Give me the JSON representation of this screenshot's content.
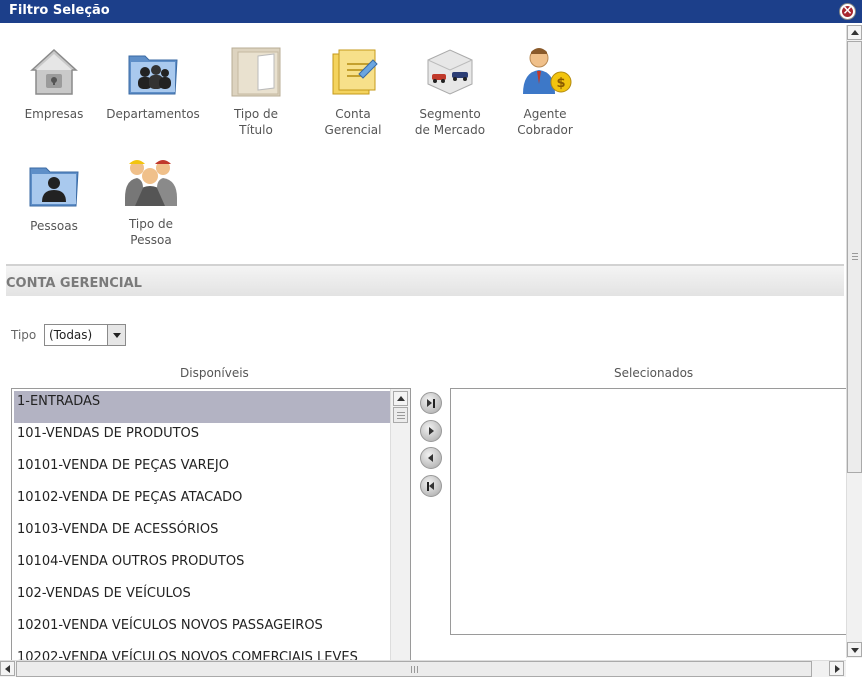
{
  "window": {
    "title": "Filtro Seleção",
    "close_label": "×"
  },
  "toolbar": {
    "items": [
      {
        "label": "Empresas",
        "icon": "building-lock-icon"
      },
      {
        "label": "Departamentos",
        "icon": "people-folder-icon"
      },
      {
        "label": "Tipo de Título",
        "icon": "document-stack-icon"
      },
      {
        "label": "Conta Gerencial",
        "icon": "ledger-document-icon"
      },
      {
        "label": "Segmento de Mercado",
        "icon": "vehicles-box-icon"
      },
      {
        "label": "Agente Cobrador",
        "icon": "money-agent-icon"
      },
      {
        "label": "Pessoas",
        "icon": "person-folder-icon"
      },
      {
        "label": "Tipo de Pessoa",
        "icon": "workers-group-icon"
      }
    ]
  },
  "section": {
    "title": "CONTA GERENCIAL"
  },
  "filter": {
    "tipo_label": "Tipo",
    "tipo_value": "(Todas)"
  },
  "lists": {
    "available_title": "Disponíveis",
    "selected_title": "Selecionados",
    "available_items": [
      "1-ENTRADAS",
      "101-VENDAS DE PRODUTOS",
      "10101-VENDA DE PEÇAS VAREJO",
      "10102-VENDA DE PEÇAS ATACADO",
      "10103-VENDA DE ACESSÓRIOS",
      "10104-VENDA OUTROS PRODUTOS",
      "102-VENDAS DE VEÍCULOS",
      "10201-VENDA VEÍCULOS NOVOS PASSAGEIROS",
      "10202-VENDA VEÍCULOS NOVOS COMERCIAIS LEVES"
    ],
    "selected_index": 0,
    "selected_items": []
  },
  "move_buttons": [
    "move-all-right",
    "move-right",
    "move-left",
    "move-all-left"
  ],
  "colors": {
    "titlebar": "#1c3f8a",
    "selection": "#b3b3c3",
    "close": "#a8262e"
  }
}
